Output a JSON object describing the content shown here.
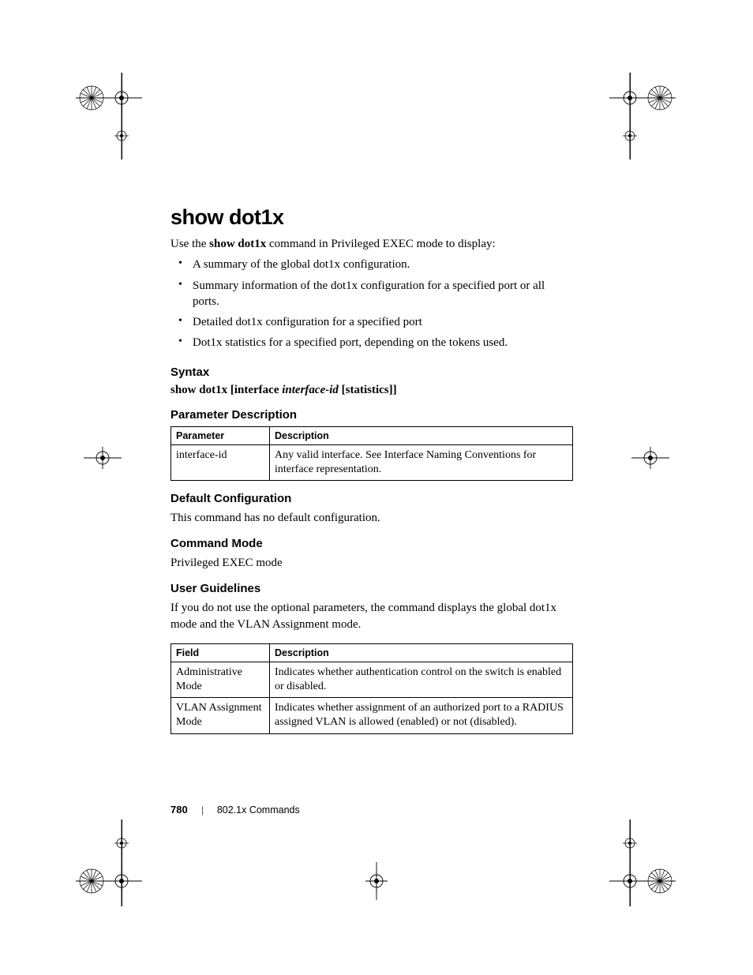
{
  "title": "show dot1x",
  "intro_prefix": "Use the ",
  "intro_bold": "show dot1x",
  "intro_suffix": " command in Privileged EXEC mode to display:",
  "bullets": [
    "A summary of the global dot1x configuration.",
    "Summary information of the dot1x configuration for a specified port or all ports.",
    "Detailed dot1x configuration for a specified port",
    "Dot1x statistics for a specified port, depending on the tokens used."
  ],
  "syntax_heading": "Syntax",
  "syntax_b1": "show dot1x ",
  "syntax_b2": "[interface ",
  "syntax_i1": "interface-id",
  "syntax_b3": " [statistics]]",
  "paramdesc_heading": "Parameter Description",
  "param_table": {
    "head": {
      "c1": "Parameter",
      "c2": "Description"
    },
    "rows": [
      {
        "c1": "interface-id",
        "c2": "Any valid interface. See Interface Naming Conventions for interface representation."
      }
    ]
  },
  "defaultcfg_heading": "Default Configuration",
  "defaultcfg_text": "This command has no default configuration.",
  "cmdmode_heading": "Command Mode",
  "cmdmode_text": "Privileged EXEC mode",
  "userguide_heading": "User Guidelines",
  "userguide_text": "If you do not use the optional parameters, the command displays the global dot1x mode and the VLAN Assignment mode.",
  "field_table": {
    "head": {
      "c1": "Field",
      "c2": "Description"
    },
    "rows": [
      {
        "c1": "Administrative Mode",
        "c2": "Indicates whether authentication control on the switch is enabled or disabled."
      },
      {
        "c1": "VLAN Assignment Mode",
        "c2": "Indicates whether assignment of an authorized port to a RADIUS assigned VLAN is allowed (enabled) or not (disabled)."
      }
    ]
  },
  "footer": {
    "page": "780",
    "section": "802.1x Commands"
  }
}
